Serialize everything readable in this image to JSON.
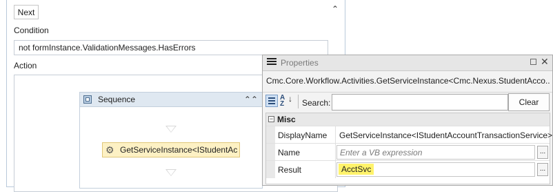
{
  "designer": {
    "next_button": "Next",
    "condition_label": "Condition",
    "condition_value": "not formInstance.ValidationMessages.HasErrors",
    "action_label": "Action",
    "sequence": {
      "title": "Sequence",
      "activity_label": "GetServiceInstance<IStudentAccountTransactionService>"
    }
  },
  "properties": {
    "title": "Properties",
    "type_name": "Cmc.Core.Workflow.Activities.GetServiceInstance<Cmc.Nexus.StudentAcco...",
    "search_label": "Search:",
    "search_value": "",
    "clear_button": "Clear",
    "category": "Misc",
    "rows": [
      {
        "name": "DisplayName",
        "value": "GetServiceInstance<IStudentAccountTransactionService>"
      },
      {
        "name": "Name",
        "placeholder": "Enter a VB expression",
        "ellipsis": "..."
      },
      {
        "name": "Result",
        "value": "AcctSvc",
        "ellipsis": "..."
      }
    ]
  },
  "colors": {
    "highlight": "#fff36b",
    "activity_fill": "#fdf1c4",
    "sequence_header": "#dfe8f1"
  }
}
